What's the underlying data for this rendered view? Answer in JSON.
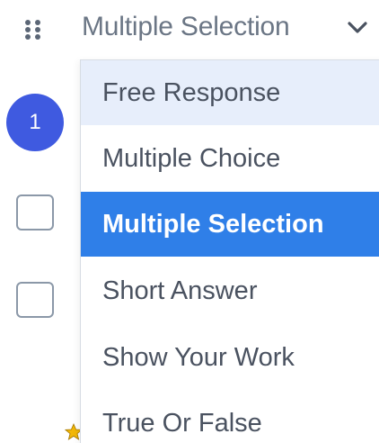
{
  "question_type_select": {
    "value": "Multiple Selection",
    "icon": "chevron-down-icon"
  },
  "drag_handle": {
    "icon": "drag-handle-icon"
  },
  "step_badge": {
    "number": "1"
  },
  "dropdown": {
    "options": [
      {
        "label": "Free Response",
        "state": "hovered"
      },
      {
        "label": "Multiple Choice",
        "state": "default"
      },
      {
        "label": "Multiple Selection",
        "state": "selected"
      },
      {
        "label": "Short Answer",
        "state": "default"
      },
      {
        "label": "Show Your Work",
        "state": "default"
      },
      {
        "label": "True Or False",
        "state": "default"
      }
    ]
  },
  "colors": {
    "accent_blue": "#3f5ae0",
    "selected_bg": "#2f7fe8",
    "hover_bg": "#e7eefb",
    "text": "#4a5260",
    "muted_text": "#6b7685",
    "star": "#f2b705"
  },
  "decorations": {
    "star_icon": "star-icon"
  }
}
